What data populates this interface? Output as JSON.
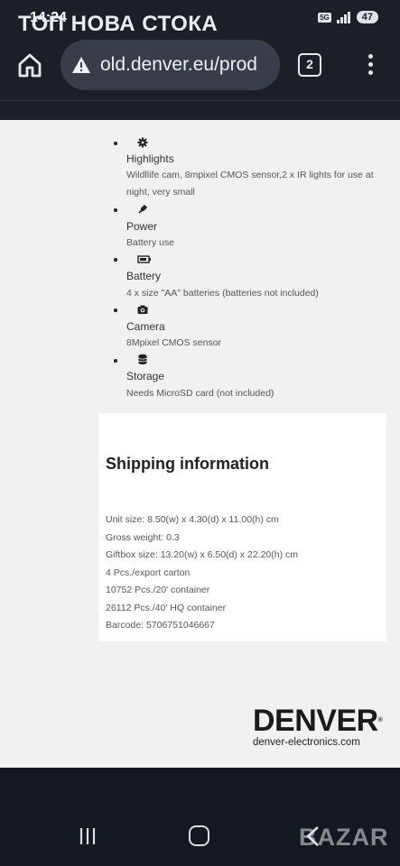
{
  "status_bar": {
    "time": "14:24",
    "network": "5G",
    "battery": "47"
  },
  "overlay_caption": "ТОП НОВА СТОКА",
  "browser": {
    "url": "old.denver.eu/prod",
    "tab_count": "2"
  },
  "specs": [
    {
      "icon": "gear-icon",
      "title": "Highlights",
      "desc": "Wildllife cam, 8mpixel CMOS sensor,2 x IR lights for use at night, very small"
    },
    {
      "icon": "plug-icon",
      "title": "Power",
      "desc": "Battery use"
    },
    {
      "icon": "battery-icon",
      "title": "Battery",
      "desc": "4 x size \"AA\" batteries (batteries not included)"
    },
    {
      "icon": "camera-icon",
      "title": "Camera",
      "desc": "8Mpixel CMOS sensor"
    },
    {
      "icon": "database-icon",
      "title": "Storage",
      "desc": "Needs MicroSD card (not included)"
    }
  ],
  "shipping": {
    "title": "Shipping information",
    "lines": [
      "Unit size: 8.50(w) x 4.30(d) x 11.00(h) cm",
      "Gross weight: 0.3",
      "Giftbox size: 13.20(w) x 6.50(d) x 22.20(h) cm",
      "4 Pcs./export carton",
      "10752 Pcs./20' container",
      "26112 Pcs./40' HQ container",
      "Barcode: 5706751046667"
    ]
  },
  "logo": {
    "brand": "DENVER",
    "website": "denver-electronics.com"
  },
  "watermark": "BAZAR",
  "colors": {
    "chrome_bg": "#1c1f26",
    "urlbar_bg": "#383d49",
    "page_bg": "#f0f1f0",
    "nav_bg": "#141820"
  }
}
